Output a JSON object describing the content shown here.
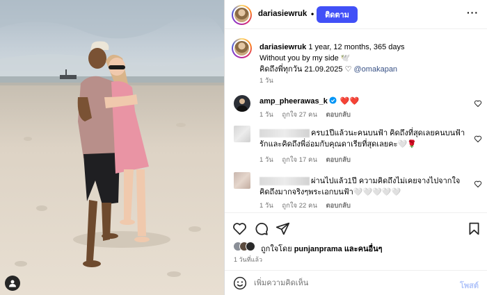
{
  "post": {
    "author": "dariasiewruk",
    "separator": "•",
    "follow_label": "ติดตาม",
    "more_label": "···",
    "caption_lines": [
      "1 year, 12 months, 365 days",
      "Without you by my side 🕊️",
      "คิดถึงพี่ทุกวัน 21.09.2025"
    ],
    "caption_heart": "♡",
    "mention": "@omakapan",
    "caption_time": "1 วัน"
  },
  "comments": [
    {
      "user": "amp_pheerawas_k",
      "verified": true,
      "text": "❤️❤️",
      "time": "1 วัน",
      "likes": "ถูกใจ 27 คน",
      "reply": "ตอบกลับ"
    },
    {
      "user": "",
      "user_hidden": true,
      "text": "ครบ1ปีแล้วนะคนบนฟ้า คิดถึงที่สุดเลยคนบนฟ้า รักและคิดถึงพี่อ่อมกับคุณดาเรียที่สุดเลยคะ🤍🌹",
      "time": "1 วัน",
      "likes": "ถูกใจ 17 คน",
      "reply": "ตอบกลับ"
    },
    {
      "user": "",
      "user_hidden": true,
      "text": "ผ่านไปแล้ว1ปี ความคิดถึงไม่เคยจางไปจากใจ คิดถึงมากจริงๆพระเอกบนฟ้า🤍🤍🤍🤍🤍",
      "time": "1 วัน",
      "likes": "ถูกใจ 22 คน",
      "reply": "ตอบกลับ"
    }
  ],
  "likes": {
    "prefix": "ถูกใจโดย",
    "user": "punjanprama",
    "suffix": "และคนอื่นๆ"
  },
  "post_time": "1 วันที่แล้ว",
  "composer": {
    "placeholder": "เพิ่มความคิดเห็น",
    "post_label": "โพสต์"
  },
  "colors": {
    "follow_button": "#4150f7",
    "mention": "#385185",
    "heart_red": "#ed1c24",
    "verified": "#0095f6",
    "post_button_disabled": "#b2c5fa"
  },
  "icons": [
    "heart-icon",
    "comment-icon",
    "share-icon",
    "bookmark-icon",
    "emoji-icon",
    "user-tag-icon",
    "verified-icon",
    "more-icon"
  ]
}
